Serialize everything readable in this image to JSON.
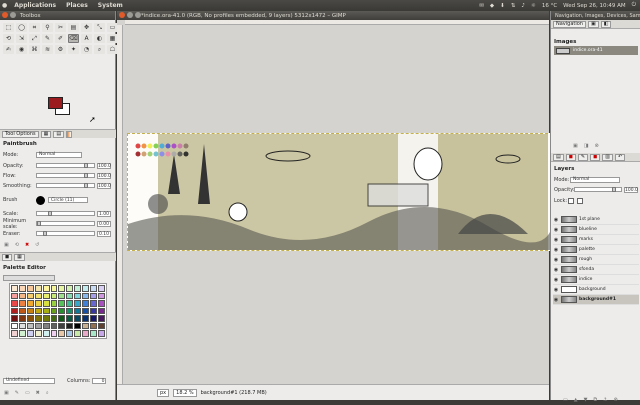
{
  "top_panel": {
    "menus": [
      "Applications",
      "Places",
      "System"
    ],
    "tray": {
      "weather": "16 °C",
      "clock": "Wed Sep 26, 10:49 AM"
    }
  },
  "toolbox": {
    "title": "Toolbox",
    "tools": [
      "⬚",
      "◯",
      "⌗",
      "⚲",
      "✂",
      "▤",
      "✥",
      "⤡",
      "▭",
      "⟲",
      "⇲",
      "⤢",
      "✎",
      "✐",
      "⌫",
      "A",
      "◐",
      "▦",
      "✍",
      "◉",
      "⌘",
      "≋",
      "⚙",
      "✦",
      "◔",
      "⌕",
      "☖"
    ],
    "tool_options": {
      "tab_label": "Tool Options",
      "section": "Paintbrush",
      "mode_label": "Mode:",
      "mode_value": "Normal",
      "opacity_label": "Opacity:",
      "opacity_value": "100.0",
      "opacity_fraction": 1.0,
      "flow_label": "Flow:",
      "flow_value": "100.0",
      "smoothing_label": "Smoothing:",
      "smoothing_value": "100.0",
      "brush_label": "Brush",
      "brush_value": "Circle (11)",
      "scale_label": "Scale:",
      "scale_value": "1.00",
      "min_scale_label": "Minimum scale:",
      "min_scale_value": "0.00",
      "eraser_label": "Eraser:",
      "eraser_value": "0.10"
    },
    "palette_editor": {
      "title": "Palette Editor",
      "name_value": "Undefined",
      "columns_label": "Columns:",
      "columns_value": "0"
    }
  },
  "image_window": {
    "title": "*indice.ora-41.0 (RGB, No profiles embedded, 9 layers) 5312x1472 – GIMP",
    "status": {
      "unit": "px",
      "zoom": "18.2 %",
      "info": "background#1 (218.7 MB)"
    }
  },
  "dock": {
    "top_tab": "Navigation, Images, Devices, Sample",
    "nav_tab": "Navigation",
    "images_title": "Images",
    "image_item": "indice.ora-41",
    "layers_title": "Layers",
    "mode_label": "Mode:",
    "mode_value": "Normal",
    "opacity_label": "Opacity:",
    "opacity_value": "100.0",
    "lock_label": "Lock:",
    "layers": [
      {
        "name": "1st plane",
        "selected": false
      },
      {
        "name": "blueline",
        "selected": false
      },
      {
        "name": "marks",
        "selected": false
      },
      {
        "name": "palette",
        "selected": false
      },
      {
        "name": "rough",
        "selected": false
      },
      {
        "name": "sfonda",
        "selected": false
      },
      {
        "name": "indice",
        "selected": false
      },
      {
        "name": "background",
        "selected": false
      },
      {
        "name": "background#1",
        "selected": true
      }
    ]
  },
  "colors": {
    "foreground": "#9b1b1f",
    "background": "#ffffff",
    "panel": "#3c3b37"
  }
}
